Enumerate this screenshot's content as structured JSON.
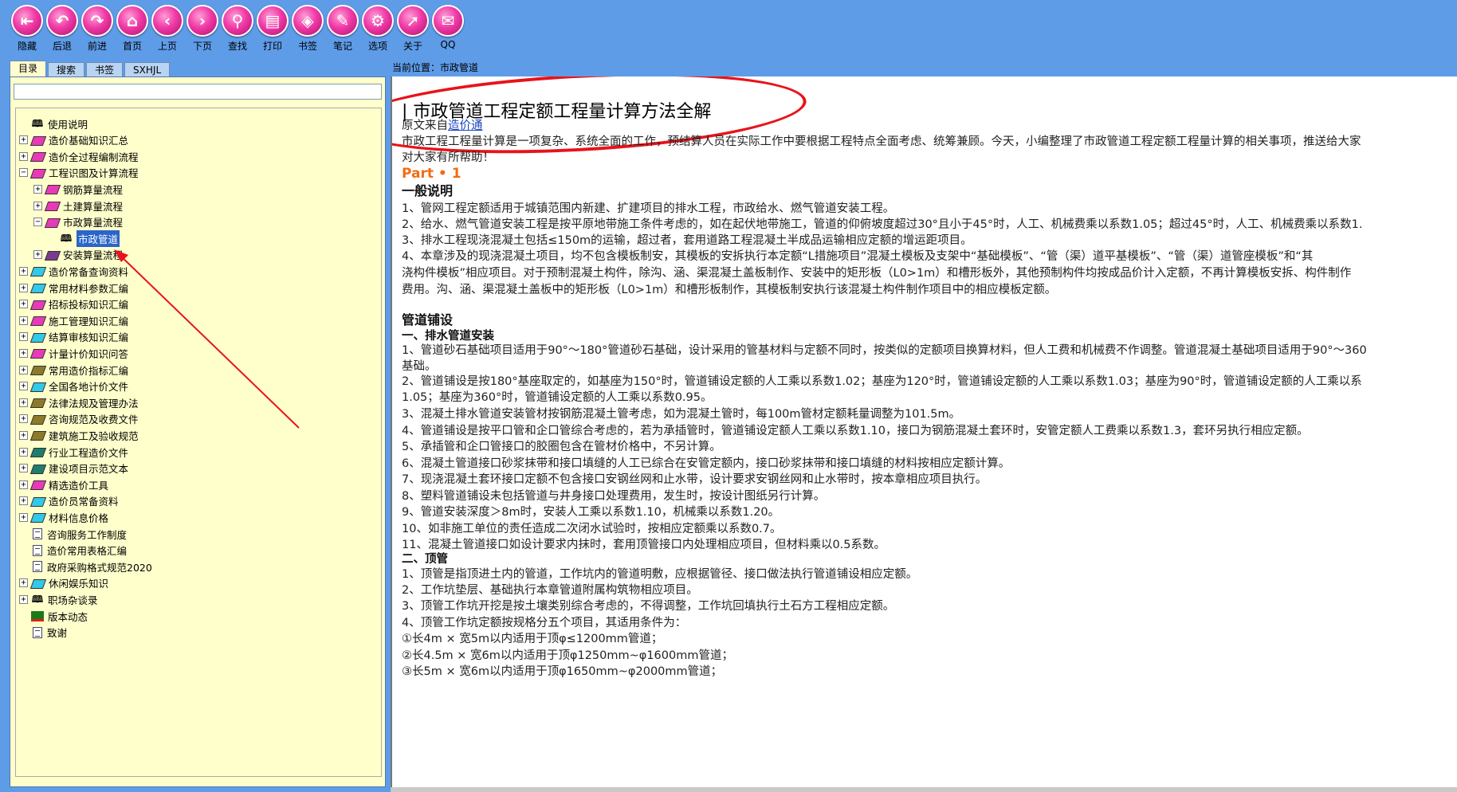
{
  "toolbar": {
    "buttons": [
      {
        "label": "隐藏",
        "icon": "hide-icon",
        "glyph": "⇤"
      },
      {
        "label": "后退",
        "icon": "back-icon",
        "glyph": "↶"
      },
      {
        "label": "前进",
        "icon": "forward-icon",
        "glyph": "↷"
      },
      {
        "label": "首页",
        "icon": "home-icon",
        "glyph": "⌂"
      },
      {
        "label": "上页",
        "icon": "prev-page-icon",
        "glyph": "‹"
      },
      {
        "label": "下页",
        "icon": "next-page-icon",
        "glyph": "›"
      },
      {
        "label": "查找",
        "icon": "binoculars-icon",
        "glyph": "⚲"
      },
      {
        "label": "打印",
        "icon": "printer-icon",
        "glyph": "▤"
      },
      {
        "label": "书签",
        "icon": "bookmark-tag-icon",
        "glyph": "◈"
      },
      {
        "label": "笔记",
        "icon": "notes-icon",
        "glyph": "✎"
      },
      {
        "label": "选项",
        "icon": "gear-icon",
        "glyph": "⚙"
      },
      {
        "label": "关于",
        "icon": "cursor-icon",
        "glyph": "➚"
      },
      {
        "label": "QQ",
        "icon": "qq-icon",
        "glyph": "✉"
      }
    ]
  },
  "left": {
    "tabs": [
      "目录",
      "搜索",
      "书签",
      "SXHJL"
    ],
    "search_value": "",
    "tree": [
      {
        "label": "使用说明",
        "type": "openbook",
        "level": 0,
        "exp": ""
      },
      {
        "label": "造价基础知识汇总",
        "type": "book",
        "color": "#e83ab8",
        "level": 0,
        "exp": "+"
      },
      {
        "label": "造价全过程编制流程",
        "type": "book",
        "color": "#e83ab8",
        "level": 0,
        "exp": "+"
      },
      {
        "label": "工程识图及计算流程",
        "type": "book",
        "color": "#e83ab8",
        "level": 0,
        "exp": "−"
      },
      {
        "label": "钢筋算量流程",
        "type": "book",
        "color": "#e83ab8",
        "level": 1,
        "exp": "+"
      },
      {
        "label": "土建算量流程",
        "type": "book",
        "color": "#e83ab8",
        "level": 1,
        "exp": "+"
      },
      {
        "label": "市政算量流程",
        "type": "book",
        "color": "#e83ab8",
        "level": 1,
        "exp": "−"
      },
      {
        "label": "市政管道",
        "type": "openbook",
        "level": 2,
        "exp": "",
        "selected": true
      },
      {
        "label": "安装算量流程",
        "type": "book",
        "color": "#7a3d8c",
        "level": 1,
        "exp": "+"
      },
      {
        "label": "造价常备查询资料",
        "type": "book",
        "color": "#33c8e8",
        "level": 0,
        "exp": "+"
      },
      {
        "label": "常用材料参数汇编",
        "type": "book",
        "color": "#33c8e8",
        "level": 0,
        "exp": "+"
      },
      {
        "label": "招标投标知识汇编",
        "type": "book",
        "color": "#e83ab8",
        "level": 0,
        "exp": "+"
      },
      {
        "label": "施工管理知识汇编",
        "type": "book",
        "color": "#e83ab8",
        "level": 0,
        "exp": "+"
      },
      {
        "label": "结算审核知识汇编",
        "type": "book",
        "color": "#33c8e8",
        "level": 0,
        "exp": "+"
      },
      {
        "label": "计量计价知识问答",
        "type": "book",
        "color": "#e83ab8",
        "level": 0,
        "exp": "+"
      },
      {
        "label": "常用造价指标汇编",
        "type": "book",
        "color": "#8c7a2a",
        "level": 0,
        "exp": "+"
      },
      {
        "label": "全国各地计价文件",
        "type": "book",
        "color": "#33c8e8",
        "level": 0,
        "exp": "+"
      },
      {
        "label": "法律法规及管理办法",
        "type": "book",
        "color": "#8c7a2a",
        "level": 0,
        "exp": "+"
      },
      {
        "label": "咨询规范及收费文件",
        "type": "book",
        "color": "#8c7a2a",
        "level": 0,
        "exp": "+"
      },
      {
        "label": "建筑施工及验收规范",
        "type": "book",
        "color": "#8c7a2a",
        "level": 0,
        "exp": "+"
      },
      {
        "label": "行业工程造价文件",
        "type": "book",
        "color": "#1e7d6e",
        "level": 0,
        "exp": "+"
      },
      {
        "label": "建设项目示范文本",
        "type": "book",
        "color": "#1e7d6e",
        "level": 0,
        "exp": "+"
      },
      {
        "label": "精选造价工具",
        "type": "book",
        "color": "#e83ab8",
        "level": 0,
        "exp": "+"
      },
      {
        "label": "造价员常备资料",
        "type": "book",
        "color": "#33c8e8",
        "level": 0,
        "exp": "+"
      },
      {
        "label": "材料信息价格",
        "type": "book",
        "color": "#33c8e8",
        "level": 0,
        "exp": "+"
      },
      {
        "label": "咨询服务工作制度",
        "type": "doc",
        "level": 0,
        "exp": ""
      },
      {
        "label": "造价常用表格汇编",
        "type": "doc",
        "level": 0,
        "exp": ""
      },
      {
        "label": "政府采购格式规范2020",
        "type": "doc",
        "level": 0,
        "exp": ""
      },
      {
        "label": "休闲娱乐知识",
        "type": "book",
        "color": "#33c8e8",
        "level": 0,
        "exp": "+"
      },
      {
        "label": "职场杂谈录",
        "type": "openbook",
        "level": 0,
        "exp": "+"
      },
      {
        "label": "版本动态",
        "type": "chart",
        "level": 0,
        "exp": ""
      },
      {
        "label": "致谢",
        "type": "doc",
        "level": 0,
        "exp": ""
      }
    ]
  },
  "location": {
    "label": "当前位置：",
    "value": "市政管道"
  },
  "article": {
    "title": "| 市政管道工程定额工程量计算方法全解",
    "source_prefix": "原文来自",
    "source_link": "造价通",
    "intro1": "市政工程工程量计算是一项复杂、系统全面的工作，预结算人员在实际工作中要根据工程特点全面考虑、统筹兼顾。今天，小编整理了市政管道工程定额工程量计算的相关事项，推送给大家",
    "intro2": "对大家有所帮助！",
    "part": "Part • 1",
    "h1": "一般说明",
    "g1": "1、管网工程定额适用于城镇范围内新建、扩建项目的排水工程，市政给水、燃气管道安装工程。",
    "g2": "2、给水、燃气管道安装工程是按平原地带施工条件考虑的，如在起伏地带施工，管道的仰俯坡度超过30°且小于45°时，人工、机械费乘以系数1.05；超过45°时，人工、机械费乘以系数1.",
    "g3": "3、排水工程现浇混凝土包括≤150m的运输，超过者，套用道路工程混凝土半成品运输相应定额的增运距项目。",
    "g4a": "4、本章涉及的现浇混凝土项目，均不包含模板制安，其模板的安拆执行本定额“L措施项目”混凝土模板及支架中“基础模板”、“管（渠）道平基模板”、“管（渠）道管座模板”和“其",
    "g4b": "浇构件模板”相应项目。对于预制混凝土构件，除沟、涵、渠混凝土盖板制作、安装中的矩形板（L0>1m）和槽形板外，其他预制构件均按成品价计入定额，不再计算模板安拆、构件制作",
    "g4c": "费用。沟、涵、渠混凝土盖板中的矩形板（L0>1m）和槽形板制作，其模板制安执行该混凝土构件制作项目中的相应模板定额。",
    "h2": "管道铺设",
    "s1": "一、排水管道安装",
    "p1a": "1、管道砂石基础项目适用于90°～180°管道砂石基础，设计采用的管基材料与定额不同时，按类似的定额项目换算材料，但人工费和机械费不作调整。管道混凝土基础项目适用于90°～360",
    "p1b": "基础。",
    "p2a": "2、管道铺设是按180°基座取定的，如基座为150°时，管道铺设定额的人工乘以系数1.02；基座为120°时，管道铺设定额的人工乘以系数1.03；基座为90°时，管道铺设定额的人工乘以系",
    "p2b": "1.05；基座为360°时，管道铺设定额的人工乘以系数0.95。",
    "p3": "3、混凝土排水管道安装管材按钢筋混凝土管考虑，如为混凝土管时，每100m管材定额耗量调整为101.5m。",
    "p4": "4、管道铺设是按平口管和企口管综合考虑的，若为承插管时，管道铺设定额人工乘以系数1.10，接口为钢筋混凝土套环时，安管定额人工费乘以系数1.3，套环另执行相应定额。",
    "p5": "5、承插管和企口管接口的胶圈包含在管材价格中，不另计算。",
    "p6": "6、混凝土管道接口砂浆抹带和接口填缝的人工已综合在安管定额内，接口砂浆抹带和接口填缝的材料按相应定额计算。",
    "p7": "7、现浇混凝土套环接口定额不包含接口安钢丝网和止水带，设计要求安钢丝网和止水带时，按本章相应项目执行。",
    "p8": "8、塑料管道铺设未包括管道与井身接口处理费用，发生时，按设计图纸另行计算。",
    "p9": "9、管道安装深度＞8m时，安装人工乘以系数1.10，机械乘以系数1.20。",
    "p10": "10、如非施工单位的责任造成二次闭水试验时，按相应定额乘以系数0.7。",
    "p11": "11、混凝土管道接口如设计要求内抹时，套用顶管接口内处理相应项目，但材料乘以0.5系数。",
    "s2": "二、顶管",
    "q1": "1、顶管是指顶进土内的管道，工作坑内的管道明敷，应根据管径、接口做法执行管道铺设相应定额。",
    "q2": "2、工作坑垫层、基础执行本章管道附属构筑物相应项目。",
    "q3": "3、顶管工作坑开挖是按土壤类别综合考虑的，不得调整，工作坑回填执行土石方工程相应定额。",
    "q4": "4、顶管工作坑定额按规格分五个项目，其适用条件为：",
    "c1": "①长4m × 宽5m以内适用于顶φ≤1200mm管道；",
    "c2": "②长4.5m × 宽6m以内适用于顶φ1250mm~φ1600mm管道；",
    "c3": "③长5m × 宽6m以内适用于顶φ1650mm~φ2000mm管道；"
  }
}
